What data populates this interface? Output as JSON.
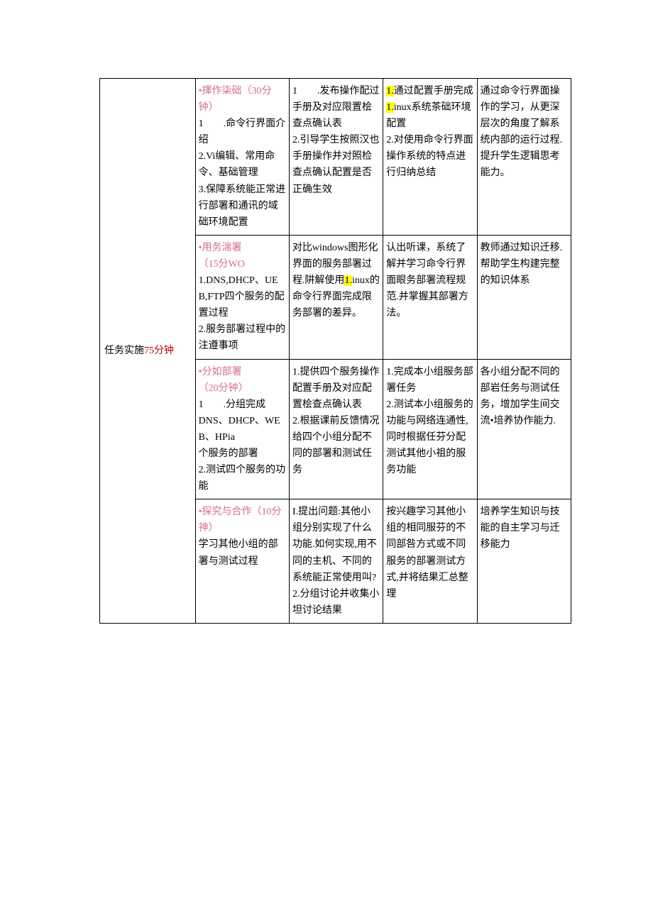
{
  "section": {
    "label_pre": "任务实施",
    "label_dur": "75分钟"
  },
  "rows": [
    {
      "c1_title": "•擇作柒础（30分钟）",
      "c1_body": "1　　.命令行界面介绍\n2.Vi编辑、常用命令、基础管理\n3.保障系统能正常进行部署和通讯的域础环境配置",
      "c2": "1　　.发布操作配过手册及对应限置桧查点确认表\n2.引导学生按照汉也手册操作并对照检查点确认配置是否正确生效",
      "c3_pre": "",
      "c3_hl1": "1.",
      "c3_mid1": "通过配置手册完成",
      "c3_hl2": "1.",
      "c3_mid2": "inux系统茶础环境配置\n2.对使用命令行界面操作系统的特点进行归纳总结",
      "c4": "通过命令行界面操作的学习，从更深层次的角度了解系统内部的运行过程.提升学生逻辑思考能力。"
    },
    {
      "c1_title": "•用务湍署\n（15分WO",
      "c1_body": "1.DNS,DHCP、UEB,FTP四个服务的配置过程\n2.服务部署过程中的注遵事项",
      "c2_pre": "对比windows图形化界面的服务部署过程.阱解使用",
      "c2_hl": "1.",
      "c2_post": "inux的命令行界面完成限务部署的差异。",
      "c3": "认出听课，系统了解并学习命令行界面眼务部署流程规范.并掌握其部署方法。",
      "c4": "教师通过知识迁移.帮助学生构建完整的知识体系"
    },
    {
      "c1_title": "•分如部署\n（20分钟）",
      "c1_body": "1　　.分组完成\nDNS、DHCP、WEB、HPia\n个服务的部署\n2.测试四个服务的功能",
      "c2": "1.提供四个服务操作配置手册及对应配置桧查点确认表\n2.根据课前反馈情况给四个小组分配不同的部署和测试任务",
      "c3": "1.完成本小组服务部署任务\n2.测试本小组服务的功能与网络连通性,同时根据任芬分配测试其他小祖的服务功能",
      "c4": "各小组分配不同的部岩任务与测试任务，增加学生间交流•培养协作能力."
    },
    {
      "c1_title": "•探究与合作（10分神）",
      "c1_body": "学习其他小组的部署与测试过程",
      "c2": "I.提出问题:其他小组分别实现了什么功能.如何实现,用不同的主机、不同的系统能正常使用叫?\n2.分组讨论并收集小坦讨论结果",
      "c3": "按兴趣学习其他小组的相同服芬的不同部咎方式或不同服务的部署测试方式,并将结果汇总整理",
      "c4": "培养学生知识与技能的自主学习与迁移能力"
    }
  ]
}
